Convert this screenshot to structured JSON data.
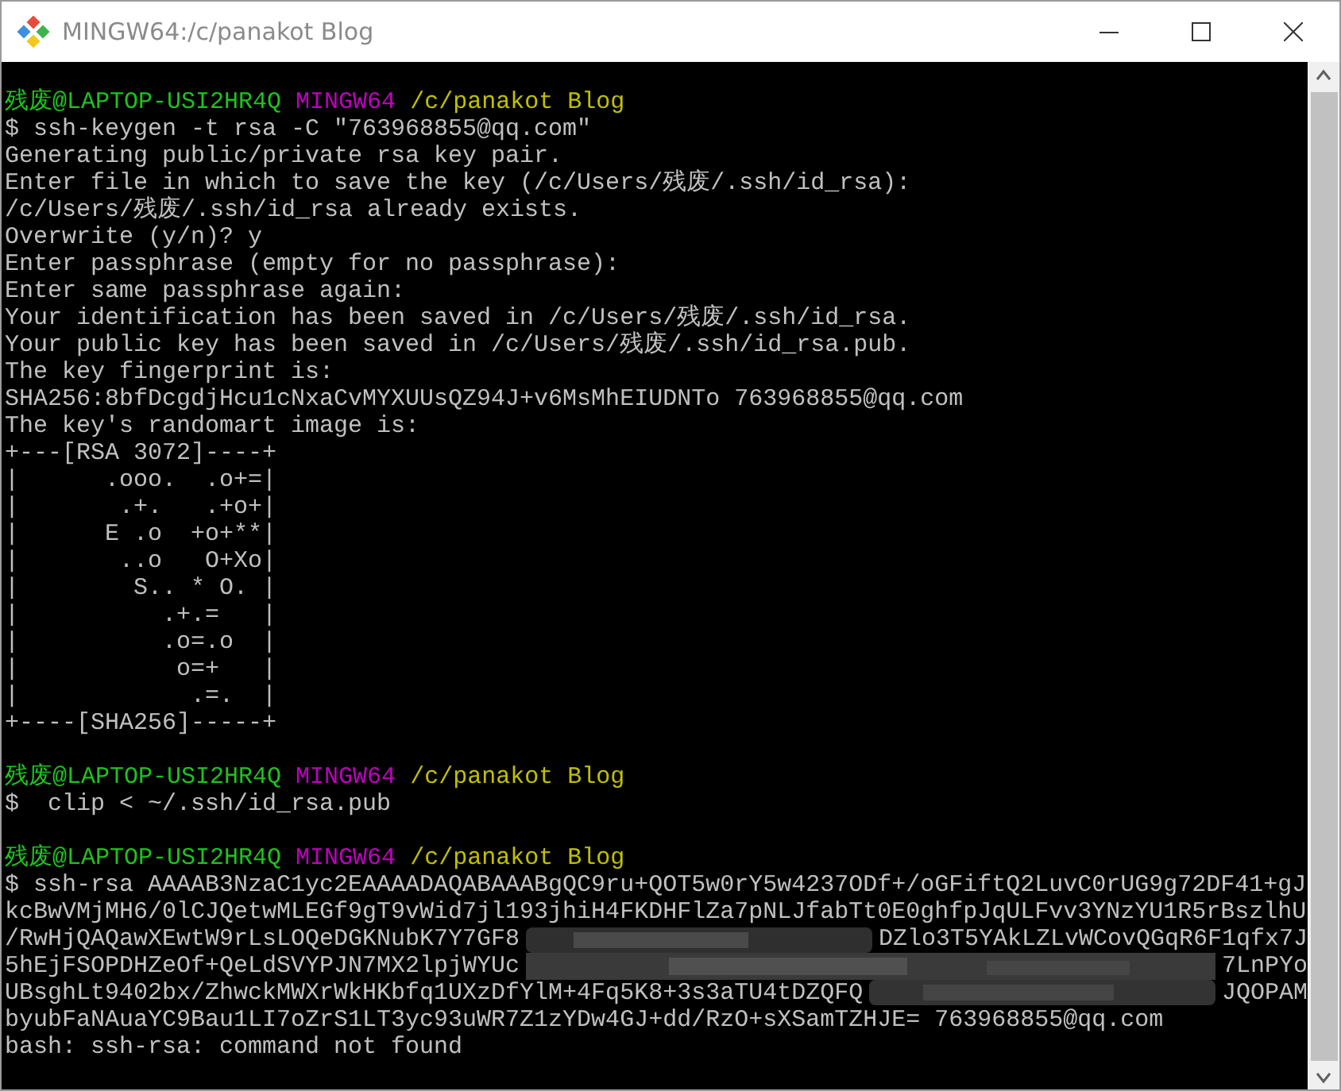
{
  "window": {
    "title": "MINGW64:/c/panakot Blog"
  },
  "terminal": {
    "lines": [
      {
        "kind": "prompt",
        "user": "残废@LAPTOP-USI2HR4Q",
        "shell": "MINGW64",
        "path": "/c/panakot Blog"
      },
      {
        "kind": "output",
        "text": "$ ssh-keygen -t rsa -C \"763968855@qq.com\""
      },
      {
        "kind": "output",
        "text": "Generating public/private rsa key pair."
      },
      {
        "kind": "output",
        "text": "Enter file in which to save the key (/c/Users/残废/.ssh/id_rsa):"
      },
      {
        "kind": "output",
        "text": "/c/Users/残废/.ssh/id_rsa already exists."
      },
      {
        "kind": "output",
        "text": "Overwrite (y/n)? y"
      },
      {
        "kind": "output",
        "text": "Enter passphrase (empty for no passphrase):"
      },
      {
        "kind": "output",
        "text": "Enter same passphrase again:"
      },
      {
        "kind": "output",
        "text": "Your identification has been saved in /c/Users/残废/.ssh/id_rsa."
      },
      {
        "kind": "output",
        "text": "Your public key has been saved in /c/Users/残废/.ssh/id_rsa.pub."
      },
      {
        "kind": "output",
        "text": "The key fingerprint is:"
      },
      {
        "kind": "output",
        "text": "SHA256:8bfDcgdjHcu1cNxaCvMYXUUsQZ94J+v6MsMhEIUDNTo 763968855@qq.com"
      },
      {
        "kind": "output",
        "text": "The key's randomart image is:"
      },
      {
        "kind": "output",
        "text": "+---[RSA 3072]----+"
      },
      {
        "kind": "output",
        "text": "|      .ooo.  .o+=|"
      },
      {
        "kind": "output",
        "text": "|       .+.   .+o+|"
      },
      {
        "kind": "output",
        "text": "|      E .o  +o+**|"
      },
      {
        "kind": "output",
        "text": "|       ..o   O+Xo|"
      },
      {
        "kind": "output",
        "text": "|        S.. * O. |"
      },
      {
        "kind": "output",
        "text": "|          .+.=   |"
      },
      {
        "kind": "output",
        "text": "|          .o=.o  |"
      },
      {
        "kind": "output",
        "text": "|           o=+   |"
      },
      {
        "kind": "output",
        "text": "|            .=.  |"
      },
      {
        "kind": "output",
        "text": "+----[SHA256]-----+"
      },
      {
        "kind": "blank"
      },
      {
        "kind": "prompt",
        "user": "残废@LAPTOP-USI2HR4Q",
        "shell": "MINGW64",
        "path": "/c/panakot Blog"
      },
      {
        "kind": "output",
        "text": "$  clip < ~/.ssh/id_rsa.pub"
      },
      {
        "kind": "blank"
      },
      {
        "kind": "prompt",
        "user": "残废@LAPTOP-USI2HR4Q",
        "shell": "MINGW64",
        "path": "/c/panakot Blog"
      },
      {
        "kind": "output",
        "text": "$ ssh-rsa AAAAB3NzaC1yc2EAAAADAQABAAABgQC9ru+QOT5w0rY5w4237ODf+/oGFiftQ2LuvC0rUG9g72DF41+gJ"
      },
      {
        "kind": "output",
        "text": "kcBwVMjMH6/0lCJQetwMLEGf9gT9vWid7jl193jhiH4FKDHFlZa7pNLJfabTt0E0ghfpJqULFvv3YNzYU1R5rBszlhU"
      },
      {
        "kind": "redacted",
        "left": "/RwHjQAQawXEwtW9rLsLOQeDGKNubK7Y7GF8",
        "right": "DZlo3T5YAkLZLvWCovQGqR6F1qfx7J"
      },
      {
        "kind": "redacted",
        "left": "5hEjFSOPDHZeOf+QeLdSVYPJN7MX2lpjWYUc",
        "right": "7LnPYo"
      },
      {
        "kind": "redacted",
        "left": "UBsghLt9402bx/ZhwckMWXrWkHKbfq1UXzDfYlM+4Fq5K8+3s3aTU4tDZQFQ",
        "right": "JQOPAM"
      },
      {
        "kind": "output",
        "text": "byubFaNAuaYC9Bau1LI7oZrS1LT3yc93uWR7Z1zYDw4GJ+dd/RzO+sXSamTZHJE= 763968855@qq.com"
      },
      {
        "kind": "output",
        "text": "bash: ssh-rsa: command not found"
      }
    ]
  }
}
